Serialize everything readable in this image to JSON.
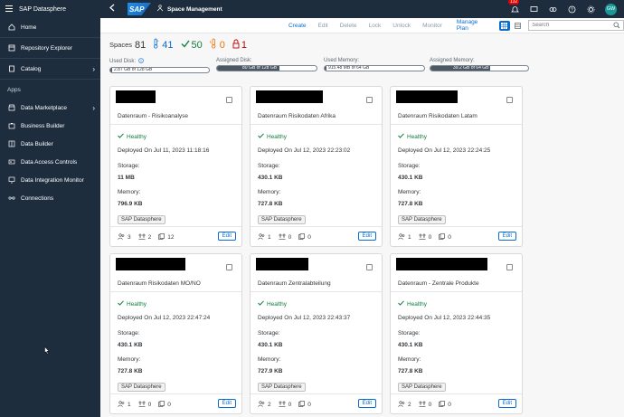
{
  "app": {
    "title": "SAP Datasphere"
  },
  "sidebar": {
    "items": [
      {
        "label": "Home",
        "icon": "home-icon"
      },
      {
        "label": "Repository Explorer",
        "icon": "repository-icon"
      },
      {
        "label": "Catalog",
        "icon": "catalog-icon",
        "expandable": true
      }
    ],
    "section_label": "Apps",
    "apps": [
      {
        "label": "Data Marketplace",
        "icon": "marketplace-icon",
        "expandable": true
      },
      {
        "label": "Business Builder",
        "icon": "business-builder-icon"
      },
      {
        "label": "Data Builder",
        "icon": "data-builder-icon"
      },
      {
        "label": "Data Access Controls",
        "icon": "access-control-icon"
      },
      {
        "label": "Data Integration Monitor",
        "icon": "monitor-icon"
      },
      {
        "label": "Connections",
        "icon": "connections-icon"
      }
    ]
  },
  "shell": {
    "logo": "SAP",
    "page_title": "Space Management",
    "notification_count": "132",
    "avatar_initials": "GW",
    "accent": "#0a6ed1",
    "background": "#1d2d3e"
  },
  "toolbar": {
    "create": "Create",
    "edit": "Edit",
    "delete": "Delete",
    "lock": "Lock",
    "unlock": "Unlock",
    "monitor": "Monitor",
    "manage_plan": "Manage Plan",
    "search_placeholder": "Search"
  },
  "stats": {
    "spaces_label": "Spaces",
    "spaces_count": "81",
    "cold": "41",
    "healthy": "50",
    "critical": "0",
    "locked": "1"
  },
  "usage": {
    "used_disk": {
      "label": "Used Disk:",
      "text": "2.87 GB of 128 GB",
      "fraction": 0.022
    },
    "assigned_disk": {
      "label": "Assigned Disk:",
      "text": "80 GB of 128 GB",
      "fraction": 0.625
    },
    "used_memory": {
      "label": "Used Memory:",
      "text": "915.48 MB of 64 GB",
      "fraction": 0.014
    },
    "assigned_memory": {
      "label": "Assigned Memory:",
      "text": "39.2 GB of 64 GB",
      "fraction": 0.612
    }
  },
  "cards": [
    {
      "name": "Datenraum - Risikoanalyse",
      "status": "Healthy",
      "deployed": "Deployed On Jul 11, 2023 11:18:16",
      "storage_label": "Storage:",
      "storage": "11 MB",
      "memory_label": "Memory:",
      "memory": "796.9 KB",
      "tag": "SAP Datasphere",
      "users": "3",
      "connections": "2",
      "objects": "12",
      "edit": "Edit"
    },
    {
      "name": "Datenraum Risikodaten Afrika",
      "status": "Healthy",
      "deployed": "Deployed On Jul 12, 2023 22:23:02",
      "storage_label": "Storage:",
      "storage": "430.1 KB",
      "memory_label": "Memory:",
      "memory": "727.8 KB",
      "tag": "SAP Datasphere",
      "users": "1",
      "connections": "0",
      "objects": "0",
      "edit": "Edit"
    },
    {
      "name": "Datenraum Risikodaten Latam",
      "status": "Healthy",
      "deployed": "Deployed On Jul 12, 2023 22:24:25",
      "storage_label": "Storage:",
      "storage": "430.1 KB",
      "memory_label": "Memory:",
      "memory": "727.8 KB",
      "tag": "SAP Datasphere",
      "users": "1",
      "connections": "0",
      "objects": "0",
      "edit": "Edit"
    },
    {
      "name": "Datenraum Risikodaten MO/NO",
      "status": "Healthy",
      "deployed": "Deployed On Jul 12, 2023 22:47:24",
      "storage_label": "Storage:",
      "storage": "430.1 KB",
      "memory_label": "Memory:",
      "memory": "727.8 KB",
      "tag": "SAP Datasphere",
      "users": "1",
      "connections": "0",
      "objects": "0",
      "edit": "Edit"
    },
    {
      "name": "Datenraum Zentralabteilung",
      "status": "Healthy",
      "deployed": "Deployed On Jul 12, 2023 22:43:37",
      "storage_label": "Storage:",
      "storage": "430.1 KB",
      "memory_label": "Memory:",
      "memory": "727.9 KB",
      "tag": "SAP Datasphere",
      "users": "2",
      "connections": "0",
      "objects": "0",
      "edit": "Edit"
    },
    {
      "name": "Datenraum - Zentrale Produkte",
      "status": "Healthy",
      "deployed": "Deployed On Jul 12, 2023 22:44:35",
      "storage_label": "Storage:",
      "storage": "430.1 KB",
      "memory_label": "Memory:",
      "memory": "727.8 KB",
      "tag": "SAP Datasphere",
      "users": "2",
      "connections": "0",
      "objects": "0",
      "edit": "Edit"
    }
  ]
}
